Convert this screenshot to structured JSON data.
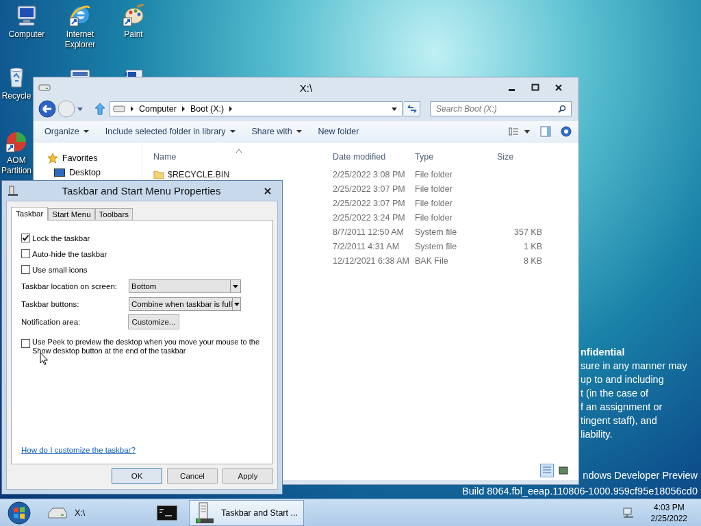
{
  "desktop_icons": [
    {
      "kind": "computer",
      "label": "Computer"
    },
    {
      "kind": "browser",
      "label": "Internet Explorer"
    },
    {
      "kind": "paint",
      "label": "Paint"
    },
    {
      "kind": "recycle",
      "label": "Recycle"
    },
    {
      "kind": "keyboard"
    },
    {
      "kind": "display"
    },
    {
      "kind": "partition",
      "label": "AOM Partition"
    }
  ],
  "desktop_text": {
    "lines": [
      {
        "text": "nfidential",
        "bold": true
      },
      {
        "text": "sure in any manner may",
        "bold": false
      },
      {
        "text": "up to and including",
        "bold": false
      },
      {
        "text": "t (in the case of",
        "bold": false
      },
      {
        "text": "f an assignment or",
        "bold": false
      },
      {
        "text": "tingent staff), and",
        "bold": false
      },
      {
        "text": "liability.",
        "bold": false
      }
    ],
    "edition": "ndows Developer Preview",
    "build": "Build 8064.fbl_eeap.110806-1000.959cf95e18056cd0"
  },
  "explorer": {
    "title": "X:\\",
    "breadcrumbs": [
      "Computer",
      "Boot (X:)"
    ],
    "search": {
      "placeholder": "Search Boot (X:)"
    },
    "toolbar": [
      {
        "label": "Organize",
        "dropdown": true
      },
      {
        "label": "Include selected folder in library",
        "dropdown": true
      },
      {
        "label": "Share with",
        "dropdown": true
      },
      {
        "label": "New folder",
        "dropdown": false
      }
    ],
    "nav": {
      "header": "Favorites",
      "items": [
        "Desktop"
      ]
    },
    "columns": [
      {
        "label": "Name",
        "sorted": true
      },
      {
        "label": "Date modified",
        "sorted": false
      },
      {
        "label": "Type",
        "sorted": false
      },
      {
        "label": "Size",
        "sorted": false
      }
    ],
    "rows": [
      {
        "name": "$RECYCLE.BIN",
        "date": "2/25/2022 3:08 PM",
        "type": "File folder"
      },
      {
        "date": "2/25/2022 3:07 PM",
        "type": "File folder"
      },
      {
        "date": "2/25/2022 3:07 PM",
        "type": "File folder"
      },
      {
        "date": "2/25/2022 3:24 PM",
        "type": "File folder"
      },
      {
        "date": "8/7/2011 12:50 AM",
        "type": "System file",
        "size": "357 KB"
      },
      {
        "date": "7/2/2011 4:31 AM",
        "type": "System file",
        "size": "1 KB"
      },
      {
        "date": "12/12/2021 6:38 AM",
        "type": "BAK File",
        "size": "8 KB"
      }
    ],
    "views": [
      {
        "kind": "details",
        "selected": true
      },
      {
        "kind": "thumbnails",
        "selected": false
      }
    ]
  },
  "dialog": {
    "title": "Taskbar and Start Menu Properties",
    "tabs": [
      {
        "label": "Taskbar",
        "selected": true
      },
      {
        "label": "Start Menu",
        "selected": false
      },
      {
        "label": "Toolbars",
        "selected": false
      }
    ],
    "checkboxes": [
      {
        "label": "Lock the taskbar",
        "checked": true
      },
      {
        "label": "Auto-hide the taskbar",
        "checked": false
      },
      {
        "label": "Use small icons",
        "checked": false
      }
    ],
    "settings": [
      {
        "label": "Taskbar location on screen:",
        "kind": "dropdown",
        "value": "Bottom"
      },
      {
        "label": "Taskbar buttons:",
        "kind": "dropdown",
        "value": "Combine when taskbar is full"
      },
      {
        "label": "Notification area:",
        "kind": "button",
        "value": "Customize..."
      }
    ],
    "peek": {
      "label": "Use Peek to preview the desktop when you move your mouse to the Show desktop button at the end of the taskbar",
      "checked": false
    },
    "link": "How do I customize the taskbar?",
    "buttons": [
      {
        "label": "OK",
        "default": true
      },
      {
        "label": "Cancel",
        "default": false
      },
      {
        "label": "Apply",
        "default": false
      }
    ]
  },
  "taskbar": {
    "items": [
      {
        "kind": "drive",
        "label": "X:\\",
        "selected": false
      },
      {
        "kind": "console",
        "selected": false
      },
      {
        "kind": "properties",
        "label": "Taskbar and Start ...",
        "selected": true
      }
    ],
    "clock": {
      "time": "4:03 PM",
      "date": "2/25/2022"
    }
  }
}
